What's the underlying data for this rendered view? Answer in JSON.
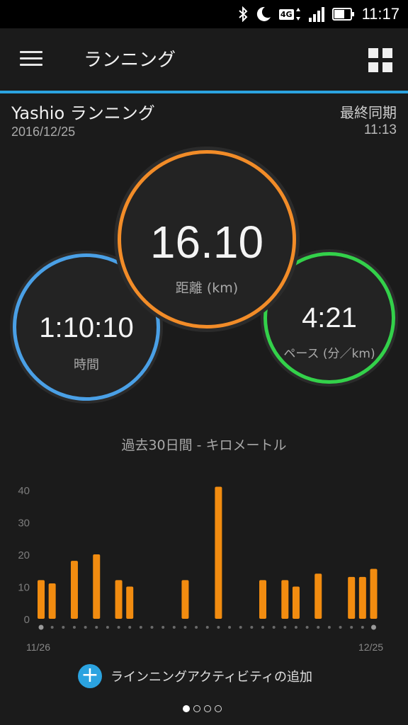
{
  "status_bar": {
    "network": "4G",
    "time": "11:17"
  },
  "app_bar": {
    "title": "ランニング"
  },
  "header": {
    "activity_name": "Yashio ランニング",
    "date": "2016/12/25",
    "sync_label": "最終同期",
    "sync_time": "11:13"
  },
  "stats": {
    "distance": {
      "value": "16.10",
      "label": "距離 (km)",
      "color": "#f28c28"
    },
    "time": {
      "value": "1:10:10",
      "label": "時間",
      "color": "#4aa0e6"
    },
    "pace": {
      "value": "4:21",
      "label": "ペース (分／km)",
      "color": "#33d14a"
    }
  },
  "chart_title": "過去30日間 - キロメートル",
  "chart_data": {
    "type": "bar",
    "x_start": "11/26",
    "x_end": "12/25",
    "yticks": [
      "0",
      "10",
      "20",
      "30",
      "40"
    ],
    "ylim": [
      0,
      42
    ],
    "bar_color": "#f28c10",
    "values": [
      12,
      11,
      0,
      18,
      0,
      20,
      0,
      12,
      10,
      0,
      0,
      0,
      0,
      12,
      0,
      0,
      41,
      0,
      0,
      0,
      12,
      0,
      12,
      10,
      0,
      14,
      0,
      0,
      13,
      13,
      15.5
    ]
  },
  "add_activity": {
    "label": "ラインニングアクティビティの追加"
  },
  "pager": {
    "count": 4,
    "active": 0
  }
}
